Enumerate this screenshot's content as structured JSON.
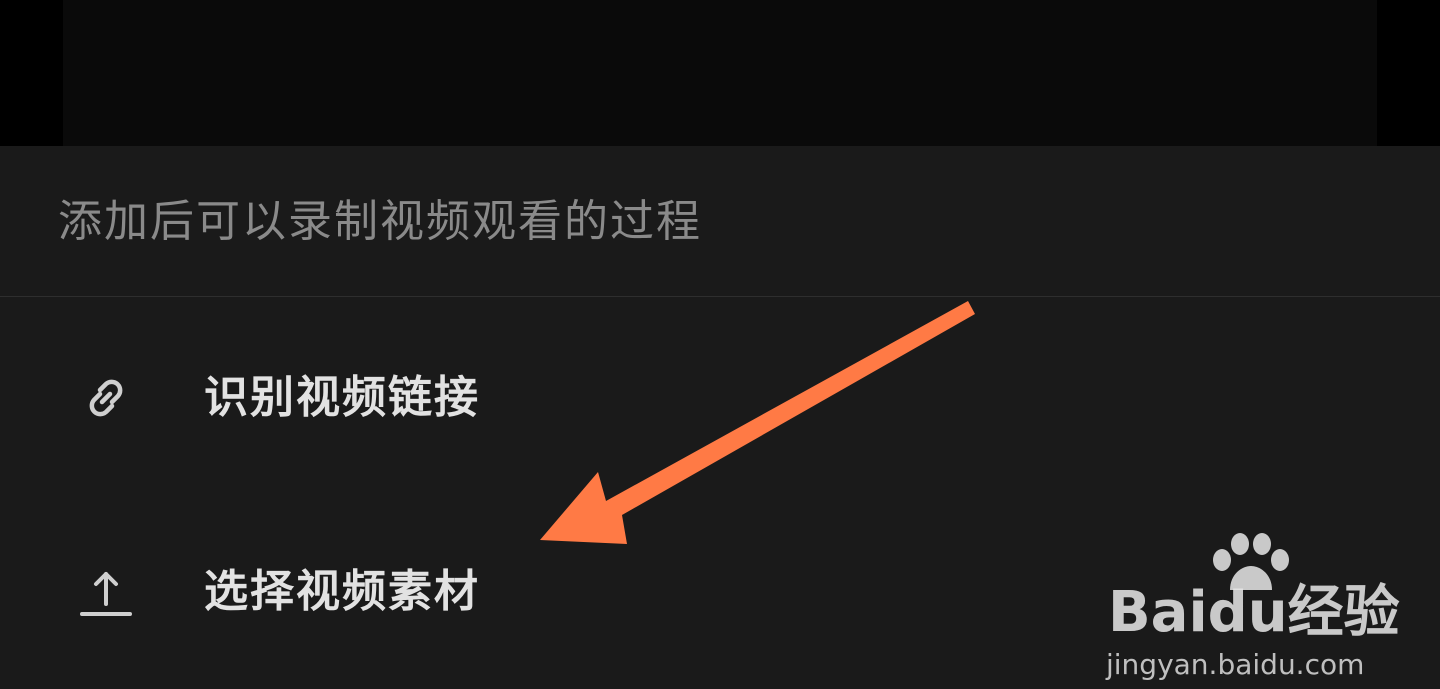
{
  "sheet": {
    "hint": "添加后可以录制视频观看的过程",
    "items": [
      {
        "label": "识别视频链接",
        "icon": "link-icon"
      },
      {
        "label": "选择视频素材",
        "icon": "upload-icon"
      }
    ]
  },
  "annotation": {
    "arrow_color": "#ff7a45"
  },
  "watermark": {
    "brand": "Baidu经验",
    "url": "jingyan.baidu.com"
  },
  "colors": {
    "sheet_bg": "#1a1a1a",
    "hint_text": "#8a8a8a",
    "item_text": "#e2e2e2"
  }
}
